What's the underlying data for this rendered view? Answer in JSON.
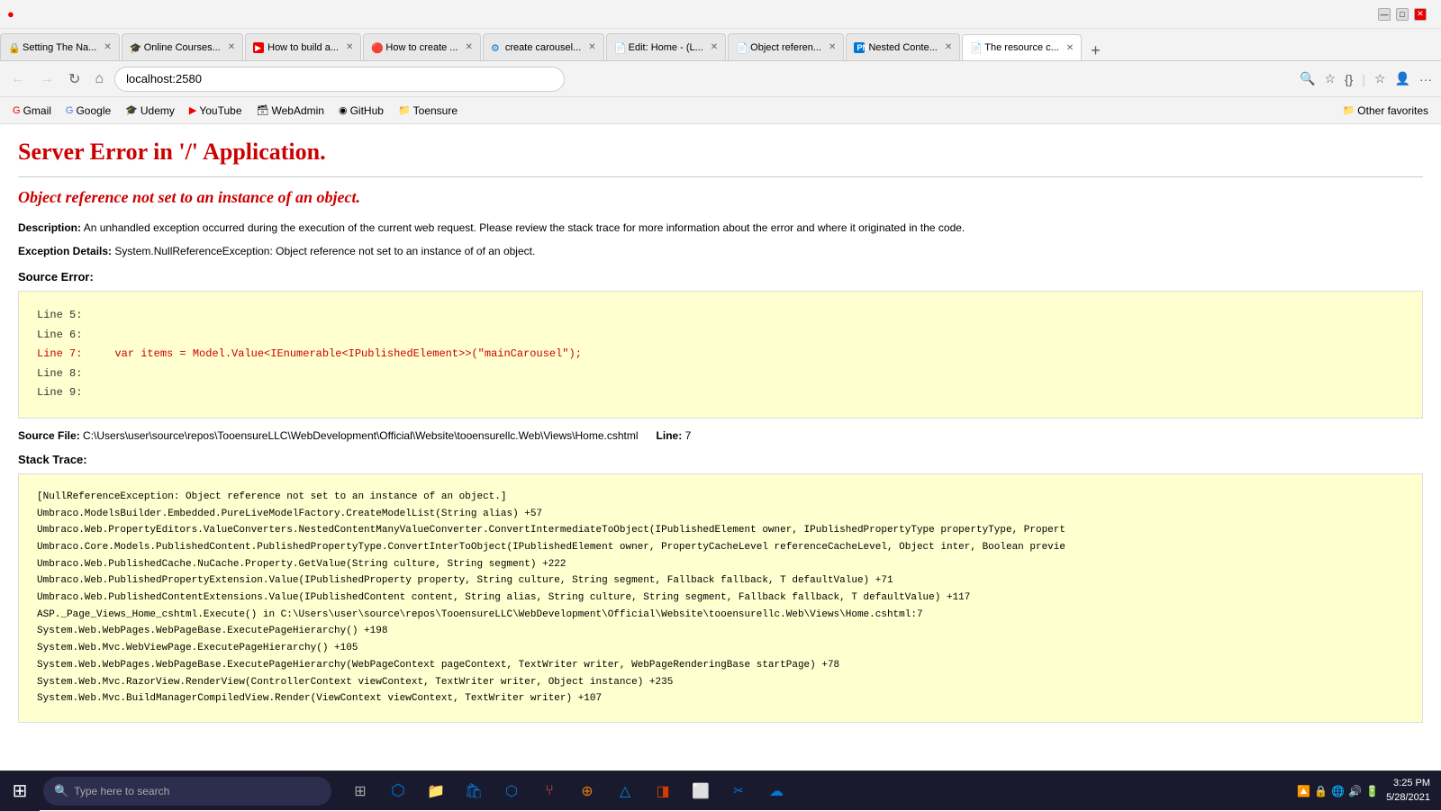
{
  "browser": {
    "titleBar": {
      "windowControls": [
        "—",
        "□",
        "✕"
      ]
    },
    "tabs": [
      {
        "id": "t1",
        "favicon": "🔒",
        "faviconColor": "fav-blue",
        "label": "Setting The Na...",
        "active": false
      },
      {
        "id": "t2",
        "favicon": "🎓",
        "faviconColor": "fav-red",
        "label": "Online Courses...",
        "active": false
      },
      {
        "id": "t3",
        "favicon": "▶",
        "faviconColor": "fav-red",
        "label": "How to build a...",
        "active": false
      },
      {
        "id": "t4",
        "favicon": "🔴",
        "faviconColor": "fav-red",
        "label": "How to create ...",
        "active": false
      },
      {
        "id": "t5",
        "favicon": "⚙",
        "faviconColor": "fav-blue",
        "label": "create carousel...",
        "active": false
      },
      {
        "id": "t6",
        "favicon": "📄",
        "faviconColor": "fav-gray",
        "label": "Edit: Home - (L...",
        "active": false
      },
      {
        "id": "t7",
        "favicon": "📄",
        "faviconColor": "fav-gray",
        "label": "Object referen...",
        "active": false
      },
      {
        "id": "t8",
        "favicon": "PN",
        "faviconColor": "fav-blue",
        "label": "Nested Conte...",
        "active": false
      },
      {
        "id": "t9",
        "favicon": "📄",
        "faviconColor": "fav-gray",
        "label": "The resource c...",
        "active": true
      }
    ],
    "addressBar": {
      "url": "localhost:2580",
      "backEnabled": false,
      "forwardEnabled": false
    },
    "bookmarks": [
      {
        "id": "b1",
        "icon": "G",
        "label": "Gmail"
      },
      {
        "id": "b2",
        "icon": "G",
        "label": "Google"
      },
      {
        "id": "b3",
        "icon": "🎓",
        "label": "Udemy"
      },
      {
        "id": "b4",
        "icon": "▶",
        "label": "YouTube"
      },
      {
        "id": "b5",
        "icon": "🗃",
        "label": "WebAdmin"
      },
      {
        "id": "b6",
        "icon": "◉",
        "label": "GitHub"
      },
      {
        "id": "b7",
        "icon": "📁",
        "label": "Toensure"
      },
      {
        "id": "b8",
        "label": "Other favorites"
      }
    ]
  },
  "page": {
    "errorTitle": "Server Error in '/' Application.",
    "errorSubtitle": "Object reference not set to an instance of an object.",
    "description": "An unhandled exception occurred during the execution of the current web request. Please review the stack trace for more information about the error and where it originated in the code.",
    "descriptionLabel": "Description:",
    "exceptionDetailsLabel": "Exception Details:",
    "exceptionDetails": "System.NullReferenceException: Object reference not set to an instance of of an object.",
    "sourceErrorLabel": "Source Error:",
    "codeLines": [
      {
        "number": "Line 5:",
        "code": "",
        "highlighted": false
      },
      {
        "number": "Line 6:",
        "code": "",
        "highlighted": false
      },
      {
        "number": "Line 7:",
        "code": "    var items = Model.Value<IEnumerable<IPublishedElement>>(\"mainCarousel\");",
        "highlighted": true
      },
      {
        "number": "Line 8:",
        "code": "",
        "highlighted": false
      },
      {
        "number": "Line 9:",
        "code": "",
        "highlighted": false
      }
    ],
    "sourceFileLabel": "Source File:",
    "sourceFilePath": "C:\\Users\\user\\source\\repos\\TooensureLLC\\WebDevelopment\\Official\\Website\\tooensurellc.Web\\Views\\Home.cshtml",
    "lineLabel": "Line:",
    "lineNumber": "7",
    "stackTraceLabel": "Stack Trace:",
    "stackLines": [
      "[NullReferenceException: Object reference not set to an instance of an object.]",
      "   Umbraco.ModelsBuilder.Embedded.PureLiveModelFactory.CreateModelList(String alias) +57",
      "   Umbraco.Web.PropertyEditors.ValueConverters.NestedContentManyValueConverter.ConvertIntermediateToObject(IPublishedElement owner, IPublishedPropertyType propertyType, Propert",
      "   Umbraco.Core.Models.PublishedContent.PublishedPropertyType.ConvertInterToObject(IPublishedElement owner, PropertyCacheLevel referenceCacheLevel, Object inter, Boolean previe",
      "   Umbraco.Web.PublishedCache.NuCache.Property.GetValue(String culture, String segment) +222",
      "   Umbraco.Web.PublishedPropertyExtension.Value(IPublishedProperty property, String culture, String segment, Fallback fallback, T defaultValue) +71",
      "   Umbraco.Web.PublishedContentExtensions.Value(IPublishedContent content, String alias, String culture, String segment, Fallback fallback, T defaultValue) +117",
      "   ASP._Page_Views_Home_cshtml.Execute() in C:\\Users\\user\\source\\repos\\TooensureLLC\\WebDevelopment\\Official\\Website\\tooensurellc.Web\\Views\\Home.cshtml:7",
      "   System.Web.WebPages.WebPageBase.ExecutePageHierarchy() +198",
      "   System.Web.Mvc.WebViewPage.ExecutePageHierarchy() +105",
      "   System.Web.WebPages.WebPageBase.ExecutePageHierarchy(WebPageContext pageContext, TextWriter writer, WebPageRenderingBase startPage) +78",
      "   System.Web.Mvc.RazorView.RenderView(ControllerContext viewContext, TextWriter writer, Object instance) +235",
      "   System.Web.Mvc.BuildManagerCompiledView.Render(ViewContext viewContext, TextWriter writer) +107"
    ]
  },
  "taskbar": {
    "searchPlaceholder": "Type here to search",
    "clock": {
      "time": "3:25 PM",
      "date": "5/28/2021"
    },
    "appIcons": [
      {
        "id": "cortana",
        "symbol": "⊙"
      },
      {
        "id": "taskview",
        "symbol": "⊞"
      },
      {
        "id": "edge",
        "symbol": "⬡"
      },
      {
        "id": "explorer",
        "symbol": "📁"
      },
      {
        "id": "store",
        "symbol": "🛍"
      },
      {
        "id": "vscode",
        "symbol": "⬡"
      },
      {
        "id": "git",
        "symbol": "⑂"
      },
      {
        "id": "blender",
        "symbol": "⊕"
      },
      {
        "id": "azure",
        "symbol": "△"
      },
      {
        "id": "office",
        "symbol": "◨"
      },
      {
        "id": "photos",
        "symbol": "⬜"
      },
      {
        "id": "snip",
        "symbol": "✂"
      },
      {
        "id": "onedrive",
        "symbol": "☁"
      }
    ],
    "systemTray": {
      "icons": [
        "🔼",
        "🔒",
        "🌐",
        "🔊",
        "🔋"
      ]
    }
  }
}
